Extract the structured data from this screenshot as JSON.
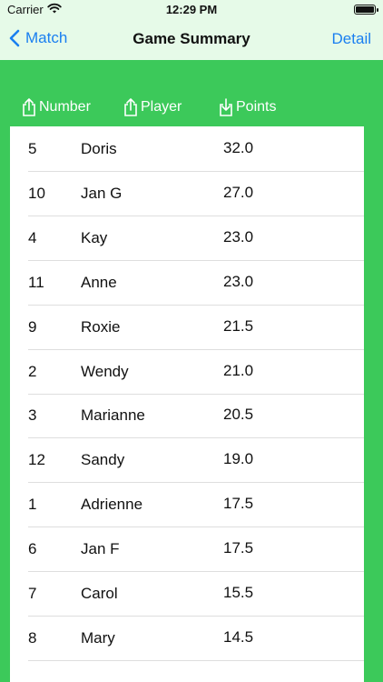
{
  "status": {
    "carrier": "Carrier",
    "time": "12:29 PM"
  },
  "nav": {
    "back_label": "Match",
    "title": "Game Summary",
    "detail_label": "Detail"
  },
  "columns": {
    "number": {
      "label": "Number",
      "icon": "share-icon"
    },
    "player": {
      "label": "Player",
      "icon": "share-icon"
    },
    "points": {
      "label": "Points",
      "icon": "download-icon"
    }
  },
  "rows": [
    {
      "number": "5",
      "player": "Doris",
      "points": "32.0"
    },
    {
      "number": "10",
      "player": "Jan G",
      "points": "27.0"
    },
    {
      "number": "4",
      "player": "Kay",
      "points": "23.0"
    },
    {
      "number": "11",
      "player": "Anne",
      "points": "23.0"
    },
    {
      "number": "9",
      "player": "Roxie",
      "points": "21.5"
    },
    {
      "number": "2",
      "player": "Wendy",
      "points": "21.0"
    },
    {
      "number": "3",
      "player": "Marianne",
      "points": "20.5"
    },
    {
      "number": "12",
      "player": "Sandy",
      "points": "19.0"
    },
    {
      "number": "1",
      "player": "Adrienne",
      "points": "17.5"
    },
    {
      "number": "6",
      "player": "Jan F",
      "points": "17.5"
    },
    {
      "number": "7",
      "player": "Carol",
      "points": "15.5"
    },
    {
      "number": "8",
      "player": "Mary",
      "points": "14.5"
    }
  ],
  "colors": {
    "accent": "#1a7ff0",
    "background": "#3cc95a",
    "navbar": "#e6fae8"
  }
}
